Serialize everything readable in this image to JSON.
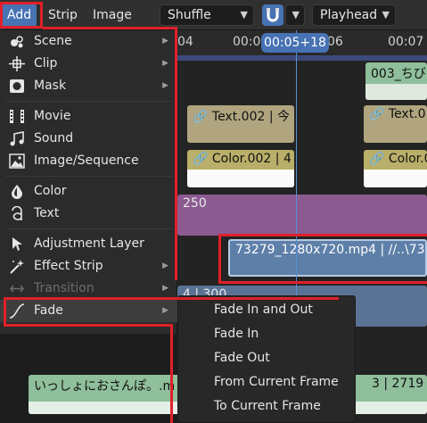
{
  "header": {
    "menus": [
      "Add",
      "Strip",
      "Image"
    ],
    "view_mode": "Shuffle",
    "snap_to": "Playhead"
  },
  "ruler": {
    "ticks": [
      "04",
      "00:05",
      "06",
      "00:07"
    ],
    "playhead": "00:05+18"
  },
  "add_menu": {
    "items": [
      {
        "label": "Scene",
        "icon": "scene-icon",
        "submenu": true
      },
      {
        "label": "Clip",
        "icon": "clip-icon",
        "submenu": true
      },
      {
        "label": "Mask",
        "icon": "mask-icon",
        "submenu": true
      },
      {
        "label": "Movie",
        "icon": "movie-icon",
        "submenu": false
      },
      {
        "label": "Sound",
        "icon": "sound-icon",
        "submenu": false
      },
      {
        "label": "Image/Sequence",
        "icon": "image-icon",
        "submenu": false
      },
      {
        "label": "Color",
        "icon": "color-icon",
        "submenu": false
      },
      {
        "label": "Text",
        "icon": "text-icon",
        "submenu": false
      },
      {
        "label": "Adjustment Layer",
        "icon": "adjustment-icon",
        "submenu": false
      },
      {
        "label": "Effect Strip",
        "icon": "effect-icon",
        "submenu": true
      },
      {
        "label": "Transition",
        "icon": "transition-icon",
        "submenu": true,
        "disabled": true
      },
      {
        "label": "Fade",
        "icon": "fade-curve-icon",
        "submenu": true
      }
    ]
  },
  "fade_submenu": [
    "Fade In and Out",
    "Fade In",
    "Fade Out",
    "From Current Frame",
    "To Current Frame"
  ],
  "strips": {
    "scene_top": "003_ちび",
    "text_a": "Text.002 | 今",
    "text_b": "Text.0",
    "color_a": "Color.002 | 4",
    "color_b": "Color.0",
    "purple_len": "250",
    "movie": "73279_1280x720.mp4 | //..\\73",
    "blue_num": "4 | 300",
    "bottom": "いっしょにおさんぽ。.m",
    "bottom_right": "3 | 2719"
  },
  "colors": {
    "accent": "#4772b3",
    "annotation": "#e0202a"
  }
}
